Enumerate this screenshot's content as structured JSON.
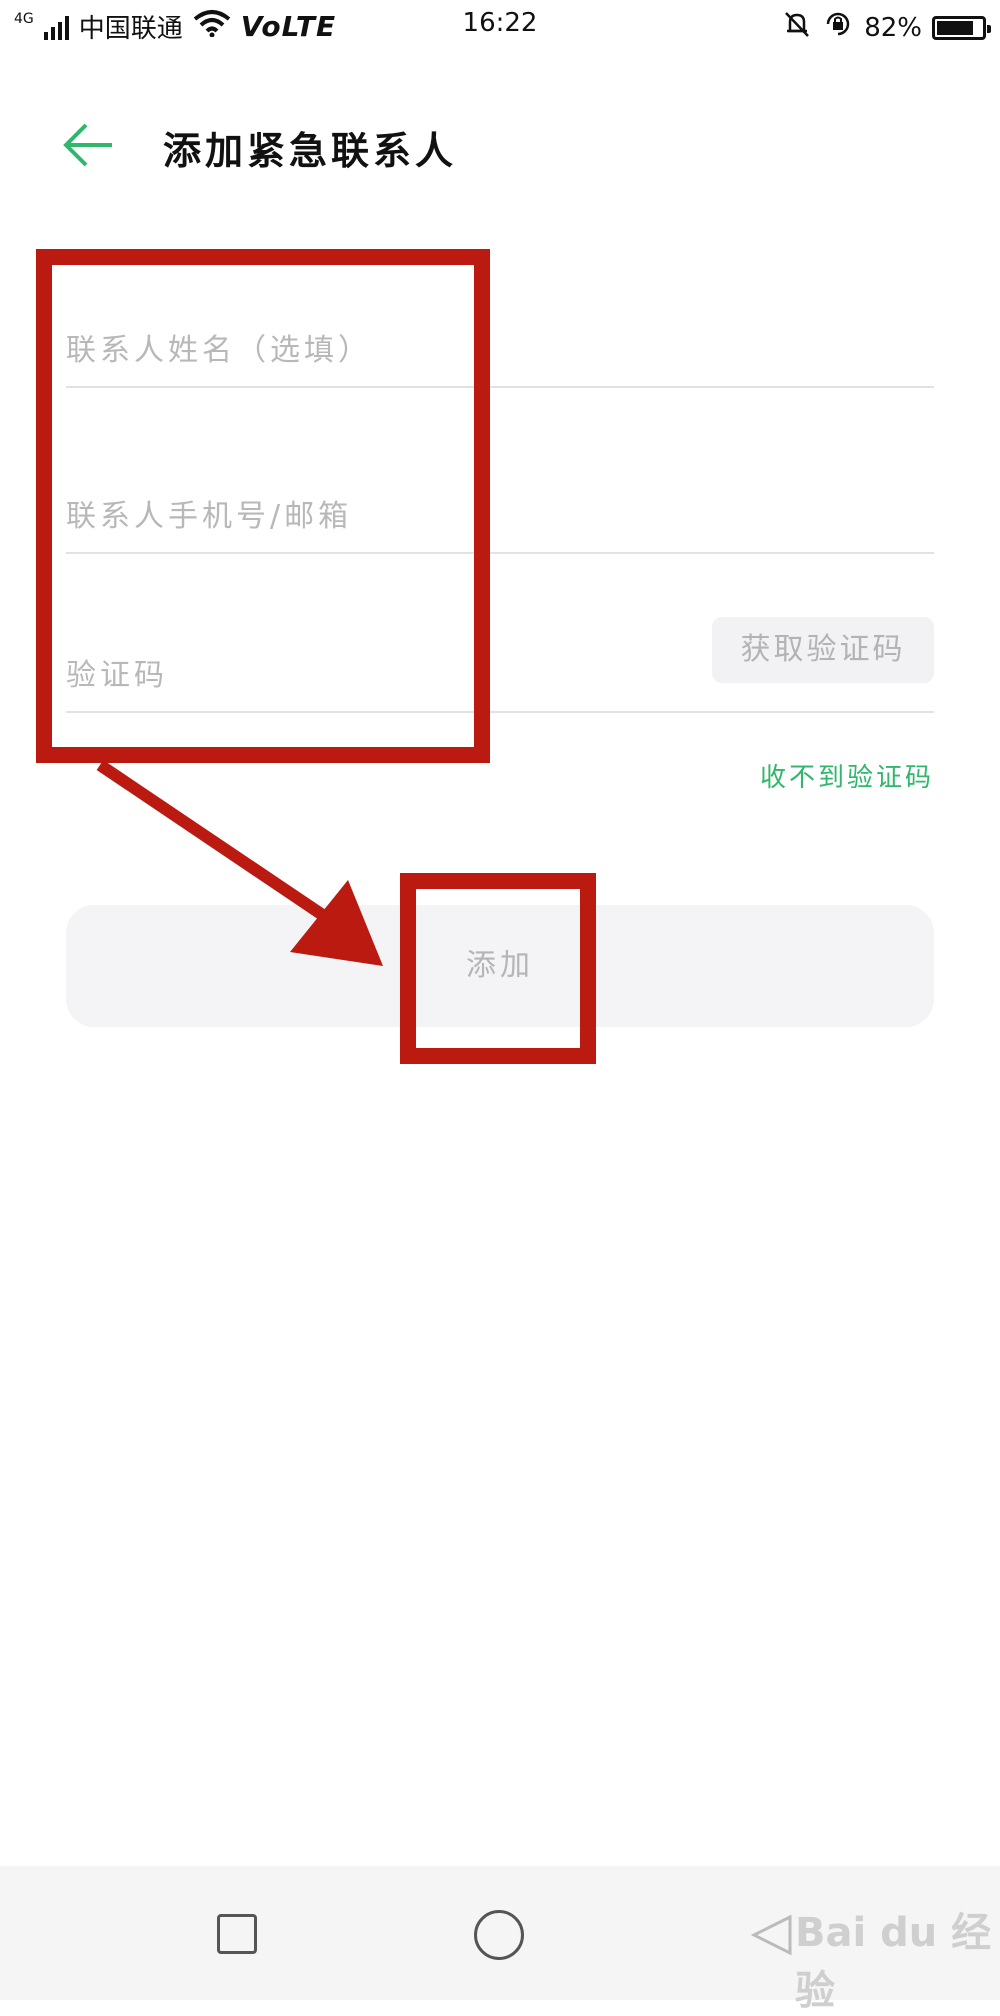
{
  "status_bar": {
    "network_type": "4G",
    "carrier": "中国联通",
    "volte": "VoLTE",
    "time": "16:22",
    "battery": "82%",
    "battery_level": 0.82
  },
  "header": {
    "title": "添加紧急联系人"
  },
  "form": {
    "name_placeholder": "联系人姓名（选填）",
    "contact_placeholder": "联系人手机号/邮箱",
    "code_placeholder": "验证码",
    "get_code_label": "获取验证码",
    "no_code_label": "收不到验证码"
  },
  "actions": {
    "add_label": "添加"
  },
  "watermark": {
    "text": "Bai du 经验"
  },
  "colors": {
    "accent_green": "#2fb86b",
    "annotation_red": "#bb1a10"
  }
}
